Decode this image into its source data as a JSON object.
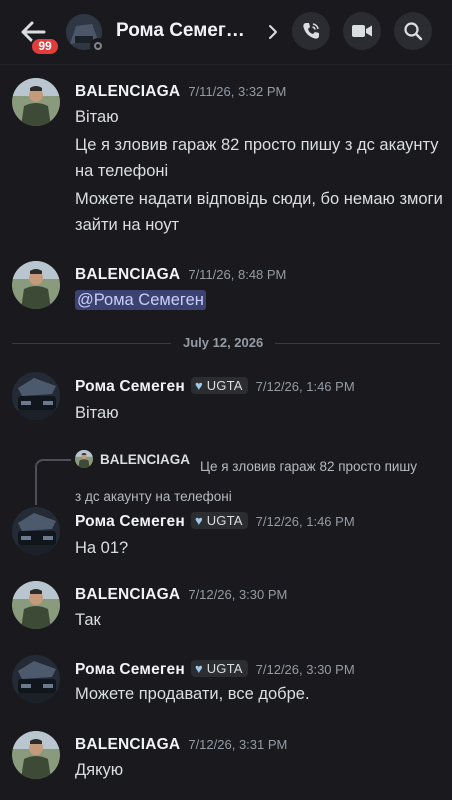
{
  "header": {
    "badge": "99",
    "title": "Рома Семег…"
  },
  "messages": [
    {
      "author": "BALENCIAGA",
      "time": "7/11/26, 3:32 PM",
      "lines": [
        "Вітаю",
        "Це я зловив гараж 82 просто пишу з дс акаунту на телефоні",
        "Можете надати відповідь сюди, бо немаю змоги зайти на ноут"
      ]
    },
    {
      "author": "BALENCIAGA",
      "time": "7/11/26, 8:48 PM",
      "mention": "@Рома Семеген"
    },
    {
      "author": "Рома Семеген",
      "tag": "UGTA",
      "time": "7/12/26, 1:46 PM",
      "text": "Вітаю"
    },
    {
      "author": "Рома Семеген",
      "tag": "UGTA",
      "time": "7/12/26, 1:46 PM",
      "text": "На 01?",
      "reply": {
        "author": "BALENCIAGA",
        "text": "Це я зловив гараж 82 просто пишу з дс акаунту на телефоні"
      }
    },
    {
      "author": "BALENCIAGA",
      "time": "7/12/26, 3:30 PM",
      "text": "Так"
    },
    {
      "author": "Рома Семеген",
      "tag": "UGTA",
      "time": "7/12/26, 3:30 PM",
      "text": "Можете продавати, все добре."
    },
    {
      "author": "BALENCIAGA",
      "time": "7/12/26, 3:31 PM",
      "text": "Дякую"
    }
  ],
  "date_divider": "July 12, 2026",
  "colors": {
    "background": "#1a1a1e",
    "mention_bg": "#3c4270",
    "badge": "#e23d3a"
  },
  "icons": [
    "back-arrow-icon",
    "chevron-right-icon",
    "phone-call-icon",
    "video-camera-icon",
    "search-icon",
    "heart-icon"
  ]
}
